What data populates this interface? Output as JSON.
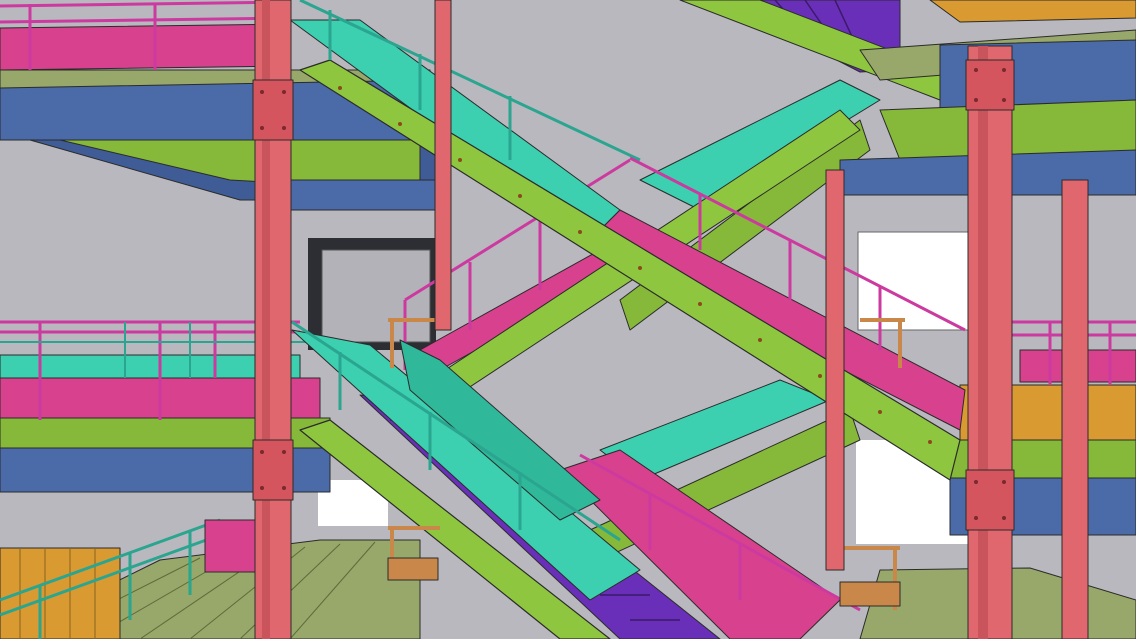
{
  "palette": {
    "background": "#c9c8cd",
    "wall": "#b9b8be",
    "opening": "#ffffff",
    "column_red": "#e0676e",
    "beam_blue": "#4a6aa8",
    "beam_green": "#86b83a",
    "stringer_green": "#8fc640",
    "grating_magenta": "#d8418e",
    "grating_cyan": "#3ccfb0",
    "grating_teal": "#2fb89a",
    "rail_magenta": "#cc3aa0",
    "rail_teal": "#2aa58f",
    "tread_purple": "#6a2fb8",
    "floor_olive": "#8a9e55",
    "floor_orange": "#d99a32",
    "deck_floor": "#97a86a",
    "handrail_tan": "#c9874a",
    "edge": "#2b2b2b"
  }
}
